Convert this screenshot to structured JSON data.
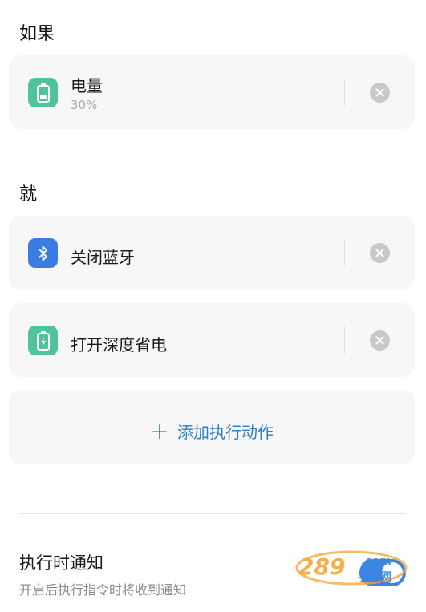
{
  "if_section": {
    "title": "如果",
    "conditions": [
      {
        "label": "电量",
        "value": "30%",
        "icon": "battery-icon"
      }
    ]
  },
  "then_section": {
    "title": "就",
    "actions": [
      {
        "label": "关闭蓝牙",
        "icon": "bluetooth-icon"
      },
      {
        "label": "打开深度省电",
        "icon": "battery-charging-icon"
      }
    ],
    "add_action_label": "添加执行动作"
  },
  "notify": {
    "title": "执行时通知",
    "description": "开启后执行指令时将收到通知",
    "enabled": true
  },
  "watermark": {
    "text": "289 手游网",
    "brand": "289"
  },
  "colors": {
    "accent": "#2f7fc1",
    "battery_green": "#4fc49a",
    "bluetooth_blue": "#3a7ce0",
    "toggle_on": "#3a86e0"
  }
}
